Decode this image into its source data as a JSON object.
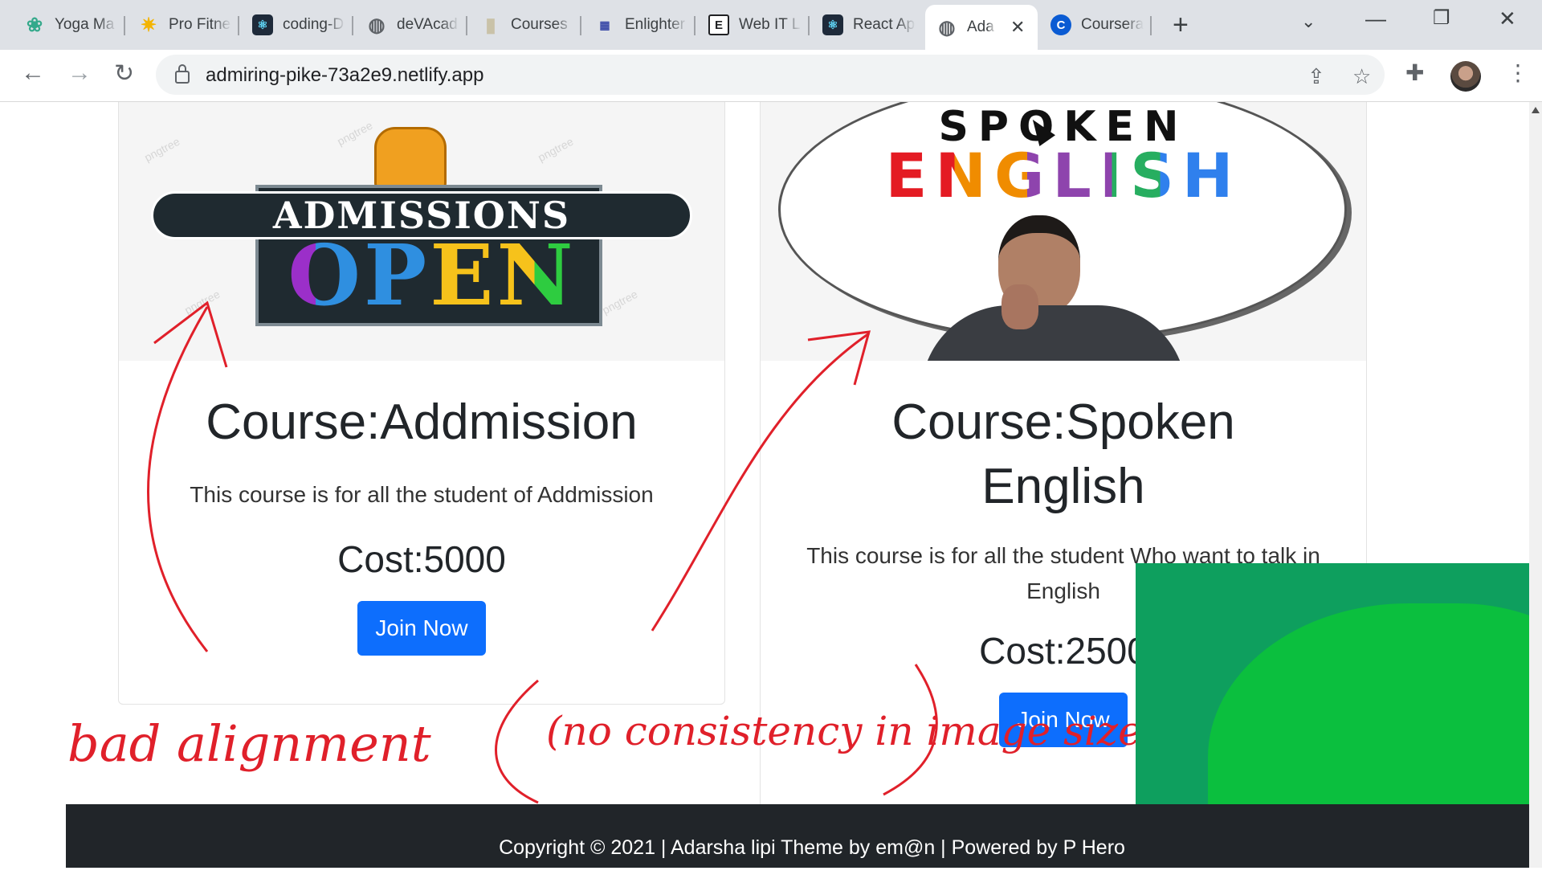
{
  "browser": {
    "tabs": [
      {
        "label": "Yoga Ma",
        "icon": "lotus-icon",
        "color": "#34a98b"
      },
      {
        "label": "Pro Fitne",
        "icon": "star-burst-icon",
        "color": "#f4b400"
      },
      {
        "label": "coding-D",
        "icon": "react-icon",
        "color": "#1e2a3a"
      },
      {
        "label": "deVAcad",
        "icon": "globe-icon",
        "color": "#5f6368"
      },
      {
        "label": "Courses",
        "icon": "book-icon",
        "color": "#c9c2a8"
      },
      {
        "label": "Enlighter",
        "icon": "enlighten-icon",
        "color": "#3b4aa8"
      },
      {
        "label": "Web IT L",
        "icon": "elementor-icon",
        "color": "#202124"
      },
      {
        "label": "React Ap",
        "icon": "react-icon",
        "color": "#1e2a3a"
      },
      {
        "label": "Ada",
        "icon": "globe-icon",
        "color": "#5f6368",
        "active": true
      },
      {
        "label": "Coursera",
        "icon": "coursera-icon",
        "color": "#0a5bd3"
      }
    ],
    "url": "admiring-pike-73a2e9.netlify.app"
  },
  "courses": [
    {
      "image_top": "ADMISSIONS",
      "image_bottom": "OPEN",
      "image_watermark": "pngtree",
      "title": "Course:Addmission",
      "description": "This course is for all the student of Addmission",
      "cost": "Cost:5000",
      "button": "Join Now"
    },
    {
      "image_top": "SPOKEN",
      "image_bottom": "ENGLISH",
      "title": "Course:Spoken English",
      "description": "This course is for all the student Who want to talk in English",
      "cost": "Cost:2500",
      "button": "Join Now"
    }
  ],
  "footer": {
    "text": "Copyright © 2021 | Adarsha lipi Theme by em@n | Powered by P Hero"
  },
  "annotations": {
    "left": "bad alignment",
    "right": "(no consistency in image size)",
    "color": "#e0202a"
  }
}
